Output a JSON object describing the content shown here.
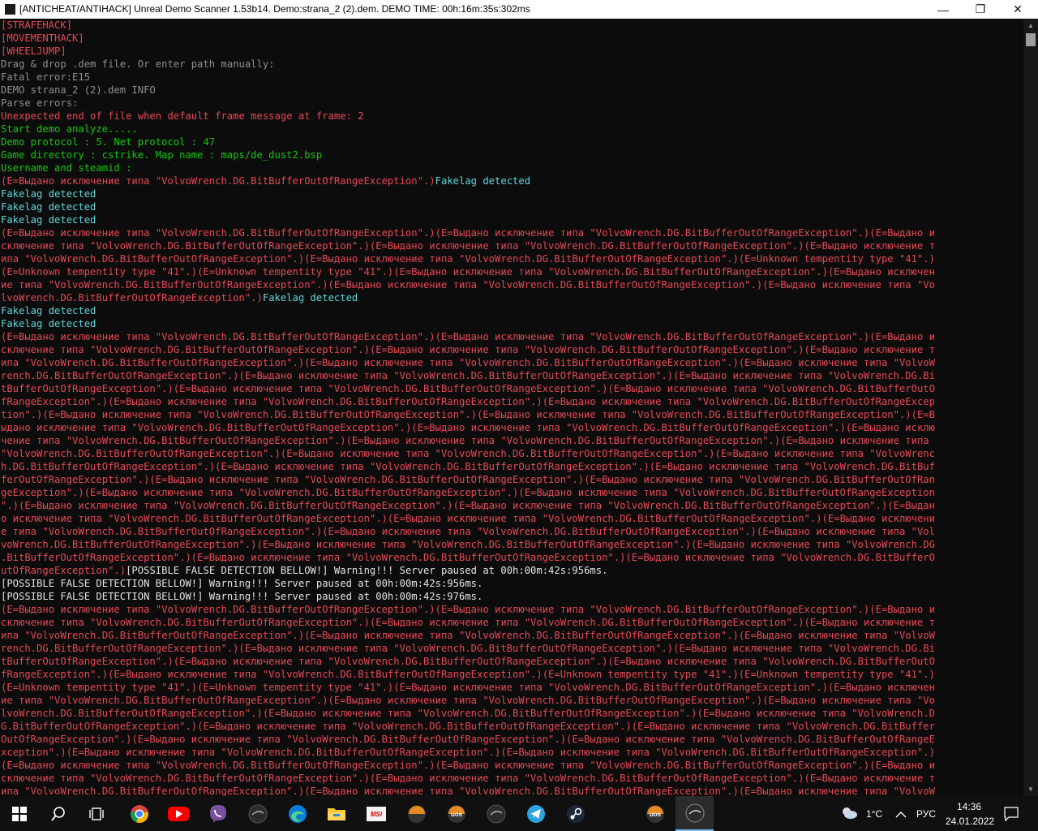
{
  "window": {
    "title": "[ANTICHEAT/ANTIHACK] Unreal Demo Scanner 1.53b14. Demo:strana_2 (2).dem. DEMO TIME: 00h:16m:35s:302ms",
    "minimize_glyph": "—",
    "restore_glyph": "❐",
    "close_glyph": "✕"
  },
  "colors": {
    "red": "#e74856",
    "green": "#16c60c",
    "cyan": "#61d6d6",
    "gray": "#8f8f8f",
    "white": "#e4e4e4",
    "background": "#0c0c0c"
  },
  "console": {
    "lines": [
      {
        "segs": [
          {
            "t": "[STRAFEHACK]",
            "c": "red"
          }
        ]
      },
      {
        "segs": [
          {
            "t": "[MOVEMENTHACK]",
            "c": "red"
          }
        ]
      },
      {
        "segs": [
          {
            "t": "[WHEELJUMP]",
            "c": "red"
          }
        ]
      },
      {
        "segs": [
          {
            "t": "Drag & drop .dem file. Or enter path manually:",
            "c": "gray"
          }
        ]
      },
      {
        "segs": [
          {
            "t": "Fatal error:E15",
            "c": "gray"
          }
        ]
      },
      {
        "segs": [
          {
            "t": "DEMO strana_2 (2).dem INFO",
            "c": "gray"
          }
        ]
      },
      {
        "segs": [
          {
            "t": "Parse errors:",
            "c": "gray"
          }
        ]
      },
      {
        "segs": [
          {
            "t": "Unexpected end of file when default frame message at frame: 2",
            "c": "red"
          }
        ]
      },
      {
        "segs": [
          {
            "t": "Start demo analyze.....",
            "c": "green"
          }
        ]
      },
      {
        "segs": [
          {
            "t": "Demo protocol : 5. Net protocol : 47",
            "c": "green"
          }
        ]
      },
      {
        "segs": [
          {
            "t": "Game directory : cstrike. Map name : maps/de_dust2.bsp",
            "c": "green"
          }
        ]
      },
      {
        "segs": [
          {
            "t": "Username and steamid :",
            "c": "green"
          }
        ]
      },
      {
        "segs": [
          {
            "t": "(E=Выдано исключение типа \"VolvoWrench.DG.BitBufferOutOfRangeException\".)",
            "c": "red"
          },
          {
            "t": "Fakelag detected",
            "c": "cyan"
          }
        ]
      },
      {
        "segs": [
          {
            "t": "Fakelag detected",
            "c": "cyan"
          }
        ]
      },
      {
        "segs": [
          {
            "t": "Fakelag detected",
            "c": "cyan"
          }
        ]
      },
      {
        "segs": [
          {
            "t": "Fakelag detected",
            "c": "cyan"
          }
        ]
      },
      {
        "segs": [
          {
            "t": "(E=Выдано исключение типа \"VolvoWrench.DG.BitBufferOutOfRangeException\".)(E=Выдано исключение типа \"VolvoWrench.DG.BitBufferOutOfRangeException\".)(E=Выдано и",
            "c": "red"
          }
        ]
      },
      {
        "segs": [
          {
            "t": "сключение типа \"VolvoWrench.DG.BitBufferOutOfRangeException\".)(E=Выдано исключение типа \"VolvoWrench.DG.BitBufferOutOfRangeException\".)(E=Выдано исключение т",
            "c": "red"
          }
        ]
      },
      {
        "segs": [
          {
            "t": "ипа \"VolvoWrench.DG.BitBufferOutOfRangeException\".)(E=Выдано исключение типа \"VolvoWrench.DG.BitBufferOutOfRangeException\".)(E=Unknown tempentity type \"41\".)",
            "c": "red"
          }
        ]
      },
      {
        "segs": [
          {
            "t": "(E=Unknown tempentity type \"41\".)(E=Unknown tempentity type \"41\".)(E=Выдано исключение типа \"VolvoWrench.DG.BitBufferOutOfRangeException\".)(E=Выдано исключен",
            "c": "red"
          }
        ]
      },
      {
        "segs": [
          {
            "t": "ие типа \"VolvoWrench.DG.BitBufferOutOfRangeException\".)(E=Выдано исключение типа \"VolvoWrench.DG.BitBufferOutOfRangeException\".)(E=Выдано исключение типа \"Vo",
            "c": "red"
          }
        ]
      },
      {
        "segs": [
          {
            "t": "lvoWrench.DG.BitBufferOutOfRangeException\".)",
            "c": "red"
          },
          {
            "t": "Fakelag detected",
            "c": "cyan"
          }
        ]
      },
      {
        "segs": [
          {
            "t": "Fakelag detected",
            "c": "cyan"
          }
        ]
      },
      {
        "segs": [
          {
            "t": "Fakelag detected",
            "c": "cyan"
          }
        ]
      },
      {
        "segs": [
          {
            "t": "(E=Выдано исключение типа \"VolvoWrench.DG.BitBufferOutOfRangeException\".)(E=Выдано исключение типа \"VolvoWrench.DG.BitBufferOutOfRangeException\".)(E=Выдано и",
            "c": "red"
          }
        ]
      },
      {
        "segs": [
          {
            "t": "сключение типа \"VolvoWrench.DG.BitBufferOutOfRangeException\".)(E=Выдано исключение типа \"VolvoWrench.DG.BitBufferOutOfRangeException\".)(E=Выдано исключение т",
            "c": "red"
          }
        ]
      },
      {
        "segs": [
          {
            "t": "ипа \"VolvoWrench.DG.BitBufferOutOfRangeException\".)(E=Выдано исключение типа \"VolvoWrench.DG.BitBufferOutOfRangeException\".)(E=Выдано исключение типа \"VolvoW",
            "c": "red"
          }
        ]
      },
      {
        "segs": [
          {
            "t": "rench.DG.BitBufferOutOfRangeException\".)(E=Выдано исключение типа \"VolvoWrench.DG.BitBufferOutOfRangeException\".)(E=Выдано исключение типа \"VolvoWrench.DG.Bi",
            "c": "red"
          }
        ]
      },
      {
        "segs": [
          {
            "t": "tBufferOutOfRangeException\".)(E=Выдано исключение типа \"VolvoWrench.DG.BitBufferOutOfRangeException\".)(E=Выдано исключение типа \"VolvoWrench.DG.BitBufferOutO",
            "c": "red"
          }
        ]
      },
      {
        "segs": [
          {
            "t": "fRangeException\".)(E=Выдано исключение типа \"VolvoWrench.DG.BitBufferOutOfRangeException\".)(E=Выдано исключение типа \"VolvoWrench.DG.BitBufferOutOfRangeExcep",
            "c": "red"
          }
        ]
      },
      {
        "segs": [
          {
            "t": "tion\".)(E=Выдано исключение типа \"VolvoWrench.DG.BitBufferOutOfRangeException\".)(E=Выдано исключение типа \"VolvoWrench.DG.BitBufferOutOfRangeException\".)(E=В",
            "c": "red"
          }
        ]
      },
      {
        "segs": [
          {
            "t": "ыдано исключение типа \"VolvoWrench.DG.BitBufferOutOfRangeException\".)(E=Выдано исключение типа \"VolvoWrench.DG.BitBufferOutOfRangeException\".)(E=Выдано исклю",
            "c": "red"
          }
        ]
      },
      {
        "segs": [
          {
            "t": "чение типа \"VolvoWrench.DG.BitBufferOutOfRangeException\".)(E=Выдано исключение типа \"VolvoWrench.DG.BitBufferOutOfRangeException\".)(E=Выдано исключение типа ",
            "c": "red"
          }
        ]
      },
      {
        "segs": [
          {
            "t": "\"VolvoWrench.DG.BitBufferOutOfRangeException\".)(E=Выдано исключение типа \"VolvoWrench.DG.BitBufferOutOfRangeException\".)(E=Выдано исключение типа \"VolvoWrenc",
            "c": "red"
          }
        ]
      },
      {
        "segs": [
          {
            "t": "h.DG.BitBufferOutOfRangeException\".)(E=Выдано исключение типа \"VolvoWrench.DG.BitBufferOutOfRangeException\".)(E=Выдано исключение типа \"VolvoWrench.DG.BitBuf",
            "c": "red"
          }
        ]
      },
      {
        "segs": [
          {
            "t": "ferOutOfRangeException\".)(E=Выдано исключение типа \"VolvoWrench.DG.BitBufferOutOfRangeException\".)(E=Выдано исключение типа \"VolvoWrench.DG.BitBufferOutOfRan",
            "c": "red"
          }
        ]
      },
      {
        "segs": [
          {
            "t": "geException\".)(E=Выдано исключение типа \"VolvoWrench.DG.BitBufferOutOfRangeException\".)(E=Выдано исключение типа \"VolvoWrench.DG.BitBufferOutOfRangeException",
            "c": "red"
          }
        ]
      },
      {
        "segs": [
          {
            "t": "\".)(E=Выдано исключение типа \"VolvoWrench.DG.BitBufferOutOfRangeException\".)(E=Выдано исключение типа \"VolvoWrench.DG.BitBufferOutOfRangeException\".)(E=Выдан",
            "c": "red"
          }
        ]
      },
      {
        "segs": [
          {
            "t": "о исключение типа \"VolvoWrench.DG.BitBufferOutOfRangeException\".)(E=Выдано исключение типа \"VolvoWrench.DG.BitBufferOutOfRangeException\".)(E=Выдано исключени",
            "c": "red"
          }
        ]
      },
      {
        "segs": [
          {
            "t": "е типа \"VolvoWrench.DG.BitBufferOutOfRangeException\".)(E=Выдано исключение типа \"VolvoWrench.DG.BitBufferOutOfRangeException\".)(E=Выдано исключение типа \"Vol",
            "c": "red"
          }
        ]
      },
      {
        "segs": [
          {
            "t": "voWrench.DG.BitBufferOutOfRangeException\".)(E=Выдано исключение типа \"VolvoWrench.DG.BitBufferOutOfRangeException\".)(E=Выдано исключение типа \"VolvoWrench.DG",
            "c": "red"
          }
        ]
      },
      {
        "segs": [
          {
            "t": ".BitBufferOutOfRangeException\".)(E=Выдано исключение типа \"VolvoWrench.DG.BitBufferOutOfRangeException\".)(E=Выдано исключение типа \"VolvoWrench.DG.BitBufferO",
            "c": "red"
          }
        ]
      },
      {
        "segs": [
          {
            "t": "utOfRangeException\".)",
            "c": "red"
          },
          {
            "t": "[POSSIBLE FALSE DETECTION BELLOW!] Warning!!! Server paused at 00h:00m:42s:956ms.",
            "c": "white"
          }
        ]
      },
      {
        "segs": [
          {
            "t": "[POSSIBLE FALSE DETECTION BELLOW!] Warning!!! Server paused at 00h:00m:42s:956ms.",
            "c": "white"
          }
        ]
      },
      {
        "segs": [
          {
            "t": "[POSSIBLE FALSE DETECTION BELLOW!] Warning!!! Server paused at 00h:00m:42s:976ms.",
            "c": "white"
          }
        ]
      },
      {
        "segs": [
          {
            "t": "(E=Выдано исключение типа \"VolvoWrench.DG.BitBufferOutOfRangeException\".)(E=Выдано исключение типа \"VolvoWrench.DG.BitBufferOutOfRangeException\".)(E=Выдано и",
            "c": "red"
          }
        ]
      },
      {
        "segs": [
          {
            "t": "сключение типа \"VolvoWrench.DG.BitBufferOutOfRangeException\".)(E=Выдано исключение типа \"VolvoWrench.DG.BitBufferOutOfRangeException\".)(E=Выдано исключение т",
            "c": "red"
          }
        ]
      },
      {
        "segs": [
          {
            "t": "ипа \"VolvoWrench.DG.BitBufferOutOfRangeException\".)(E=Выдано исключение типа \"VolvoWrench.DG.BitBufferOutOfRangeException\".)(E=Выдано исключение типа \"VolvoW",
            "c": "red"
          }
        ]
      },
      {
        "segs": [
          {
            "t": "rench.DG.BitBufferOutOfRangeException\".)(E=Выдано исключение типа \"VolvoWrench.DG.BitBufferOutOfRangeException\".)(E=Выдано исключение типа \"VolvoWrench.DG.Bi",
            "c": "red"
          }
        ]
      },
      {
        "segs": [
          {
            "t": "tBufferOutOfRangeException\".)(E=Выдано исключение типа \"VolvoWrench.DG.BitBufferOutOfRangeException\".)(E=Выдано исключение типа \"VolvoWrench.DG.BitBufferOutO",
            "c": "red"
          }
        ]
      },
      {
        "segs": [
          {
            "t": "fRangeException\".)(E=Выдано исключение типа \"VolvoWrench.DG.BitBufferOutOfRangeException\".)(E=Unknown tempentity type \"41\".)(E=Unknown tempentity type \"41\".)",
            "c": "red"
          }
        ]
      },
      {
        "segs": [
          {
            "t": "(E=Unknown tempentity type \"41\".)(E=Unknown tempentity type \"41\".)(E=Выдано исключение типа \"VolvoWrench.DG.BitBufferOutOfRangeException\".)(E=Выдано исключен",
            "c": "red"
          }
        ]
      },
      {
        "segs": [
          {
            "t": "ие типа \"VolvoWrench.DG.BitBufferOutOfRangeException\".)(E=Выдано исключение типа \"VolvoWrench.DG.BitBufferOutOfRangeException\".)(E=Выдано исключение типа \"Vo",
            "c": "red"
          }
        ]
      },
      {
        "segs": [
          {
            "t": "lvoWrench.DG.BitBufferOutOfRangeException\".)(E=Выдано исключение типа \"VolvoWrench.DG.BitBufferOutOfRangeException\".)(E=Выдано исключение типа \"VolvoWrench.D",
            "c": "red"
          }
        ]
      },
      {
        "segs": [
          {
            "t": "G.BitBufferOutOfRangeException\".)(E=Выдано исключение типа \"VolvoWrench.DG.BitBufferOutOfRangeException\".)(E=Выдано исключение типа \"VolvoWrench.DG.BitBuffer",
            "c": "red"
          }
        ]
      },
      {
        "segs": [
          {
            "t": "OutOfRangeException\".)(E=Выдано исключение типа \"VolvoWrench.DG.BitBufferOutOfRangeException\".)(E=Выдано исключение типа \"VolvoWrench.DG.BitBufferOutOfRangeE",
            "c": "red"
          }
        ]
      },
      {
        "segs": [
          {
            "t": "xception\".)(E=Выдано исключение типа \"VolvoWrench.DG.BitBufferOutOfRangeException\".)(E=Выдано исключение типа \"VolvoWrench.DG.BitBufferOutOfRangeException\".)",
            "c": "red"
          }
        ]
      },
      {
        "segs": [
          {
            "t": "(E=Выдано исключение типа \"VolvoWrench.DG.BitBufferOutOfRangeException\".)(E=Выдано исключение типа \"VolvoWrench.DG.BitBufferOutOfRangeException\".)(E=Выдано и",
            "c": "red"
          }
        ]
      },
      {
        "segs": [
          {
            "t": "сключение типа \"VolvoWrench.DG.BitBufferOutOfRangeException\".)(E=Выдано исключение типа \"VolvoWrench.DG.BitBufferOutOfRangeException\".)(E=Выдано исключение т",
            "c": "red"
          }
        ]
      },
      {
        "segs": [
          {
            "t": "ипа \"VolvoWrench.DG.BitBufferOutOfRangeException\".)(E=Выдано исключение типа \"VolvoWrench.DG.BitBufferOutOfRangeException\".)(E=Выдано исключение типа \"VolvoW",
            "c": "red"
          }
        ]
      }
    ]
  },
  "taskbar": {
    "items": [
      {
        "name": "start-button",
        "icon": "windows-logo-icon"
      },
      {
        "name": "search-button",
        "icon": "search-icon"
      },
      {
        "name": "task-view-button",
        "icon": "task-view-icon"
      },
      {
        "name": "chrome-button",
        "icon": "chrome-icon"
      },
      {
        "name": "youtube-button",
        "icon": "youtube-icon"
      },
      {
        "name": "viber-button",
        "icon": "viber-icon"
      },
      {
        "name": "app-dark-1-button",
        "icon": "dark-circle-icon"
      },
      {
        "name": "edge-button",
        "icon": "edge-icon"
      },
      {
        "name": "explorer-button",
        "icon": "folder-icon"
      },
      {
        "name": "msi-button",
        "icon": "msi-icon"
      },
      {
        "name": "uos-1-button",
        "icon": "uos-icon",
        "label": "uos"
      },
      {
        "name": "uos-2-button",
        "icon": "uos-icon",
        "label": "uos"
      },
      {
        "name": "app-dark-2-button",
        "icon": "dark-circle-icon"
      },
      {
        "name": "telegram-button",
        "icon": "telegram-icon"
      },
      {
        "name": "steam-button",
        "icon": "steam-icon"
      },
      {
        "name": "uos-3-button",
        "icon": "uos-icon",
        "label": "uos"
      },
      {
        "name": "scanner-active-button",
        "icon": "dark-circle-icon"
      }
    ],
    "tray": {
      "temperature": "1°C",
      "language": "РУС",
      "time": "14:36",
      "date": "24.01.2022"
    }
  }
}
